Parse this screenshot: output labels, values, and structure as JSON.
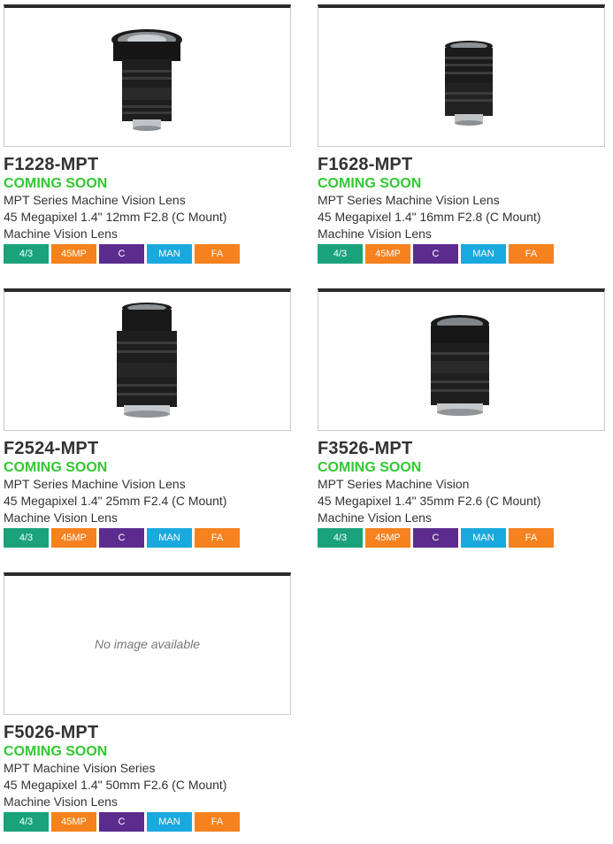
{
  "colors": {
    "status_green": "#32c832",
    "tag_format": "#1aa37a",
    "tag_mp": "#f5821f",
    "tag_mount": "#5b2c8e",
    "tag_focus": "#1aa9de",
    "tag_fa": "#f5821f"
  },
  "tags": [
    "4/3",
    "45MP",
    "C",
    "MAN",
    "FA"
  ],
  "products": [
    {
      "model": "F1228-MPT",
      "status": "COMING SOON",
      "line1": "MPT Series Machine Vision Lens",
      "line2": "45 Megapixel  1.4\" 12mm F2.8 (C Mount)",
      "line3": "Machine Vision Lens",
      "image": "lens-photo"
    },
    {
      "model": "F1628-MPT",
      "status": "COMING SOON",
      "line1": "MPT Series Machine Vision Lens",
      "line2": "45 Megapixel  1.4\" 16mm F2.8 (C Mount)",
      "line3": "Machine Vision Lens",
      "image": "lens-photo"
    },
    {
      "model": "F2524-MPT",
      "status": "COMING SOON",
      "line1": "MPT Series Machine Vision Lens",
      "line2": "45 Megapixel  1.4\" 25mm F2.4 (C Mount)",
      "line3": "Machine Vision Lens",
      "image": "lens-photo"
    },
    {
      "model": "F3526-MPT",
      "status": "COMING SOON",
      "line1": "MPT Series Machine Vision",
      "line2": "45 Megapixel  1.4\" 35mm F2.6 (C Mount)",
      "line3": "Machine Vision Lens",
      "image": "lens-photo"
    },
    {
      "model": "F5026-MPT",
      "status": "COMING SOON",
      "line1": "MPT Machine Vision Series",
      "line2": "45 Megapixel  1.4\" 50mm F2.6 (C Mount)",
      "line3": "Machine Vision Lens",
      "no_image_text": "No image available"
    }
  ]
}
